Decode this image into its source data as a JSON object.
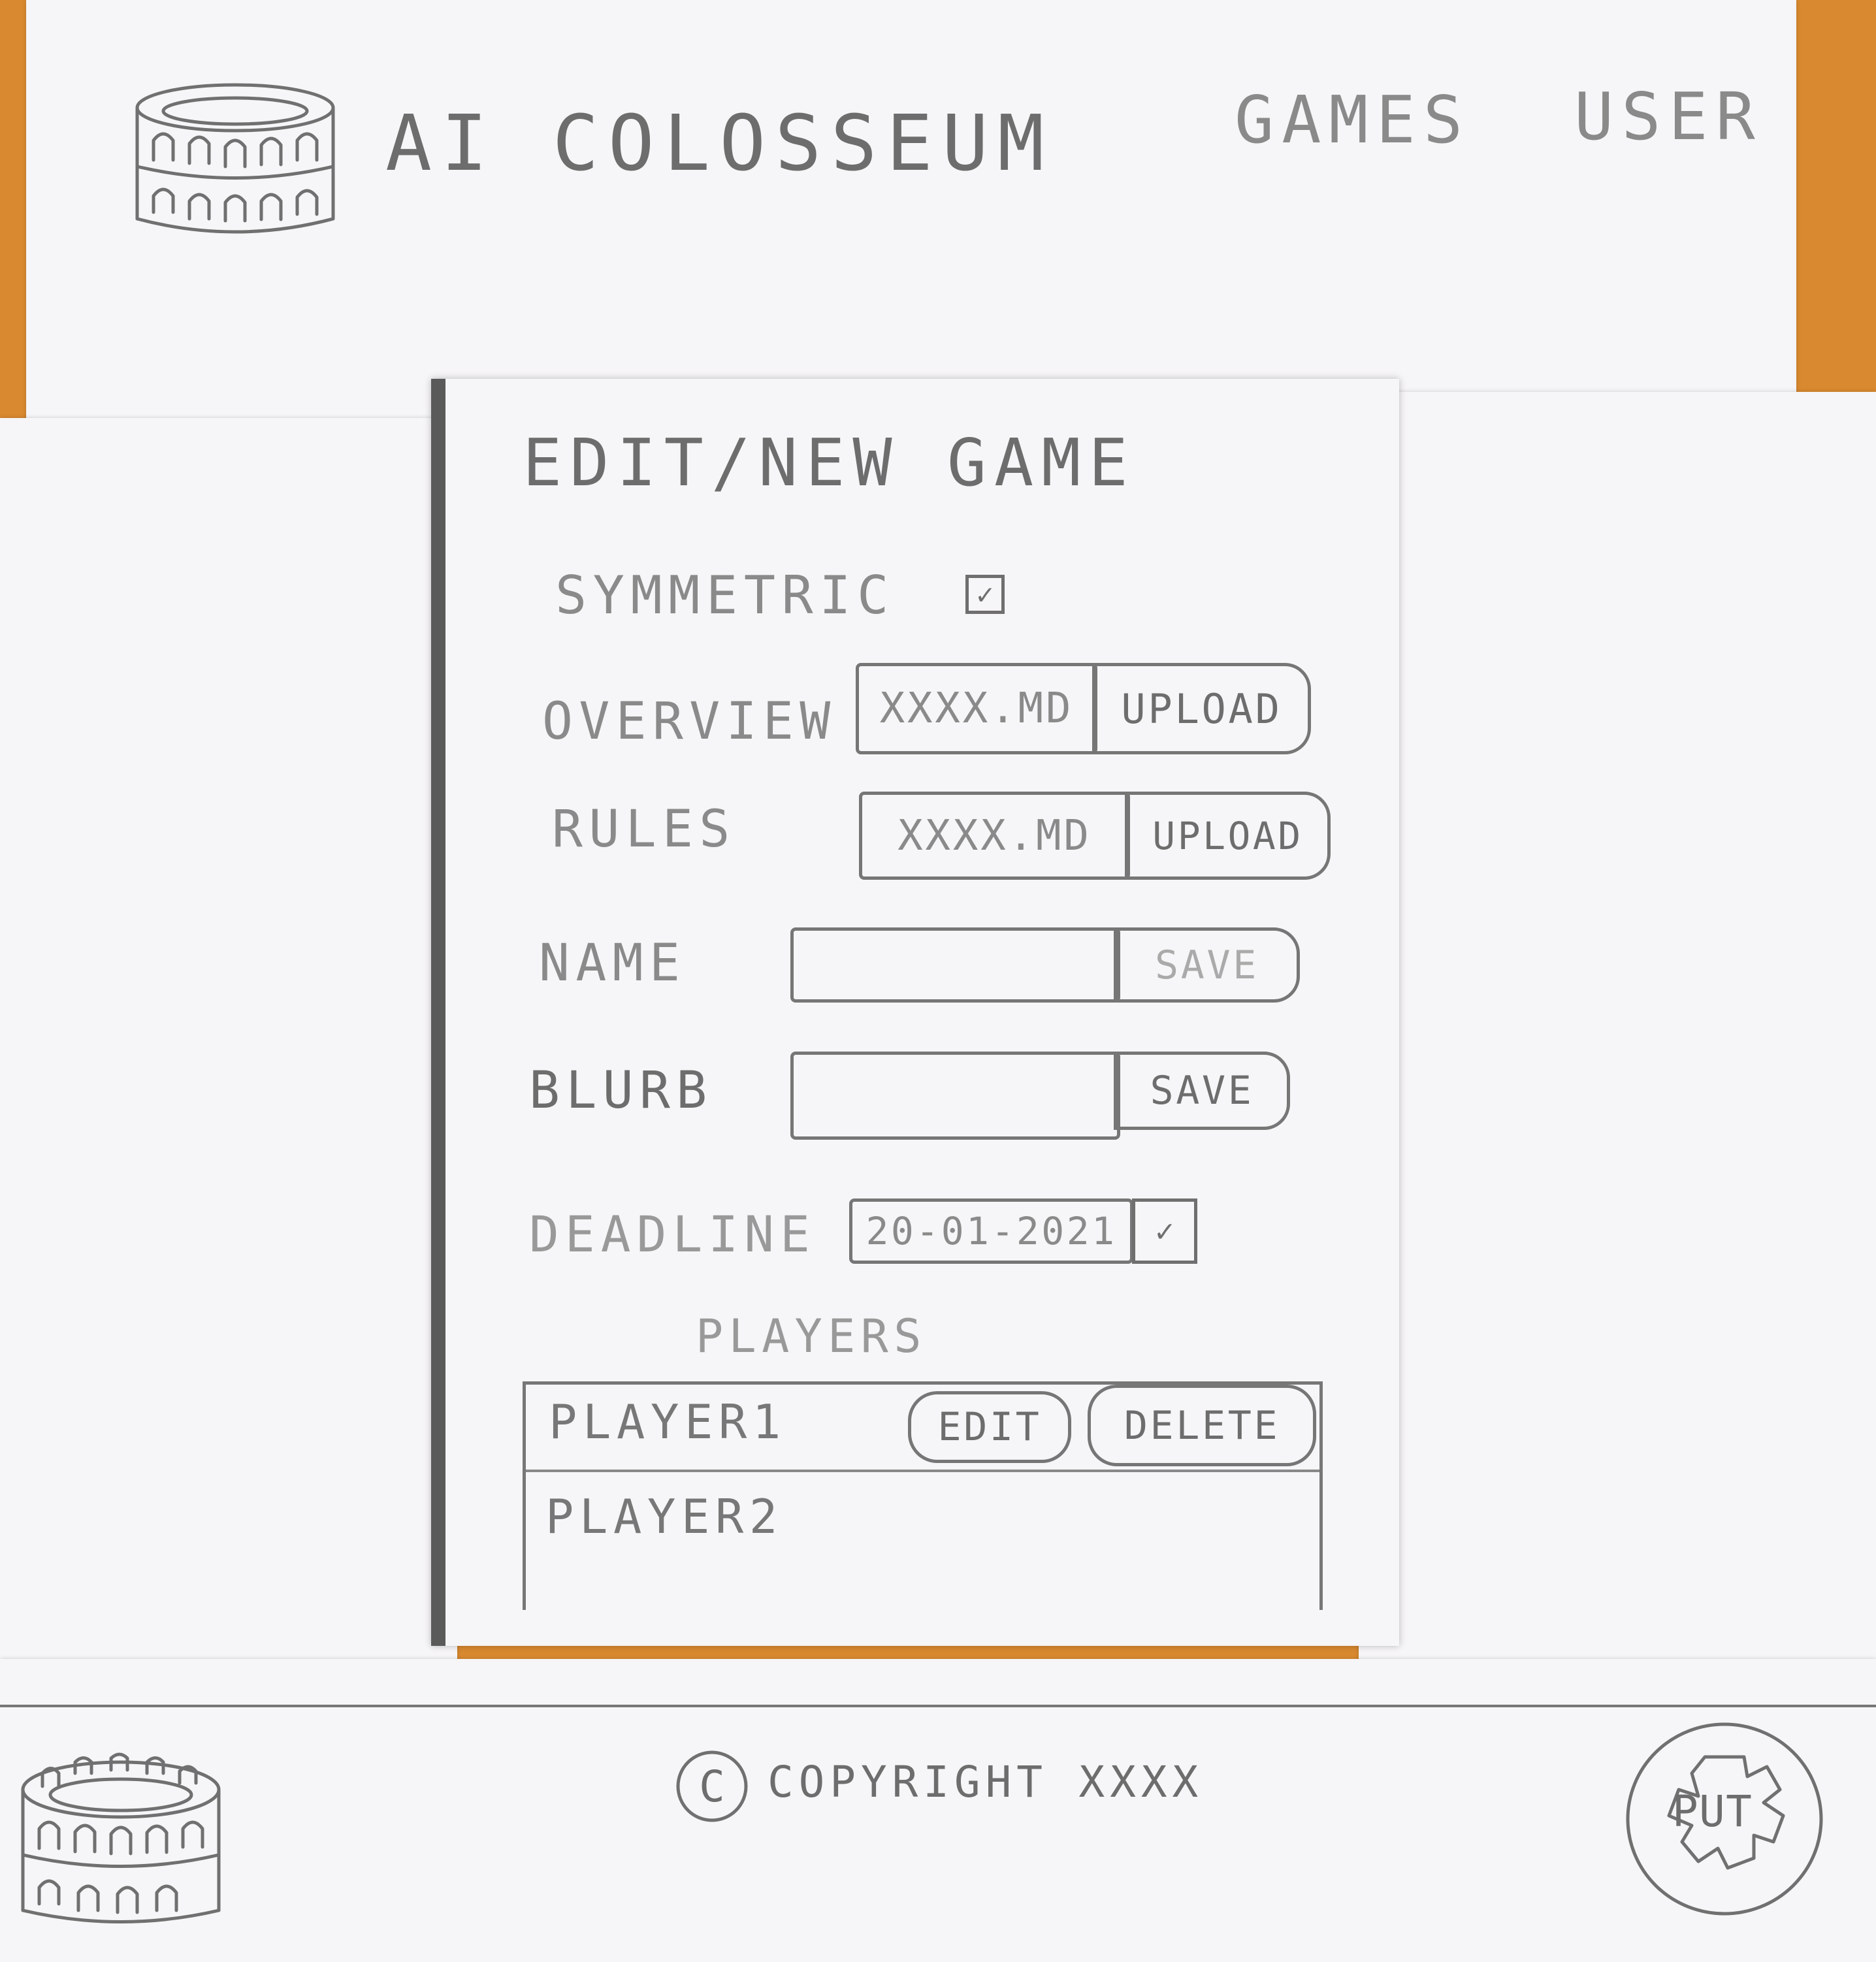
{
  "header": {
    "app_title": "AI COLOSSEUM",
    "nav": {
      "games_label": "GAMES",
      "user_label": "USER"
    }
  },
  "form": {
    "title": "EDIT/NEW GAME",
    "symmetric": {
      "label": "SYMMETRIC",
      "checked": true,
      "check_glyph": "✓"
    },
    "overview": {
      "label": "OVERVIEW",
      "file_value": "XXXX.MD",
      "upload_label": "UPLOAD"
    },
    "rules": {
      "label": "RULES",
      "file_value": "XXXX.MD",
      "upload_label": "UPLOAD"
    },
    "name": {
      "label": "NAME",
      "value": "",
      "save_label": "SAVE"
    },
    "blurb": {
      "label": "BLURB",
      "value": "",
      "save_label": "SAVE"
    },
    "deadline": {
      "label": "DEADLINE",
      "value": "20-01-2021",
      "picker_glyph": "✓"
    },
    "players": {
      "title": "PLAYERS",
      "rows": [
        {
          "name": "PLAYER1",
          "edit_label": "EDIT",
          "delete_label": "DELETE"
        },
        {
          "name": "PLAYER2"
        }
      ]
    }
  },
  "footer": {
    "copyright_symbol": "C",
    "copyright_text": "COPYRIGHT   XXXX",
    "university_logo_text": "PUT"
  },
  "icons": {
    "app_logo": "colosseum-icon",
    "footer_logo": "colosseum-icon",
    "university_logo": "gear-seal-icon",
    "copyright": "copyright-icon"
  }
}
